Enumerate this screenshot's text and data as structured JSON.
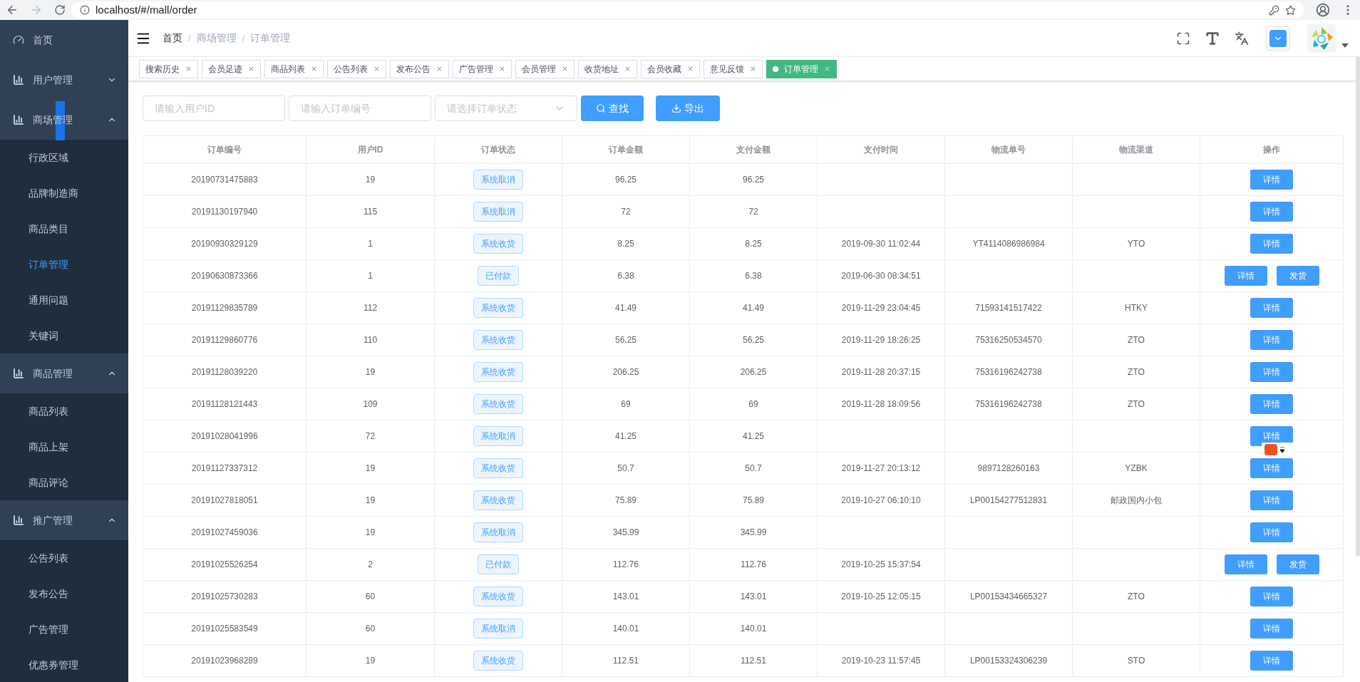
{
  "browser": {
    "url": "localhost/#/mall/order"
  },
  "sidebar": {
    "items": [
      {
        "label": "首页",
        "kind": "link",
        "selected": false
      },
      {
        "label": "用户管理",
        "kind": "group",
        "expanded": false
      },
      {
        "label": "商场管理",
        "kind": "group",
        "expanded": true,
        "children": [
          {
            "label": "行政区域",
            "selected": false
          },
          {
            "label": "品牌制造商",
            "selected": false
          },
          {
            "label": "商品类目",
            "selected": false
          },
          {
            "label": "订单管理",
            "selected": true
          },
          {
            "label": "通用问题",
            "selected": false
          },
          {
            "label": "关键词",
            "selected": false
          }
        ]
      },
      {
        "label": "商品管理",
        "kind": "group",
        "expanded": true,
        "children": [
          {
            "label": "商品列表",
            "selected": false
          },
          {
            "label": "商品上架",
            "selected": false
          },
          {
            "label": "商品评论",
            "selected": false
          }
        ]
      },
      {
        "label": "推广管理",
        "kind": "group",
        "expanded": true,
        "children": [
          {
            "label": "公告列表",
            "selected": false
          },
          {
            "label": "发布公告",
            "selected": false
          },
          {
            "label": "广告管理",
            "selected": false
          },
          {
            "label": "优惠券管理",
            "selected": false
          }
        ]
      }
    ]
  },
  "breadcrumb": {
    "separator": "/",
    "items": [
      "首页",
      "商场管理",
      "订单管理"
    ]
  },
  "tags": [
    {
      "label": "搜索历史",
      "selected": false
    },
    {
      "label": "会员足迹",
      "selected": false
    },
    {
      "label": "商品列表",
      "selected": false
    },
    {
      "label": "公告列表",
      "selected": false
    },
    {
      "label": "发布公告",
      "selected": false
    },
    {
      "label": "广告管理",
      "selected": false
    },
    {
      "label": "会员管理",
      "selected": false
    },
    {
      "label": "收货地址",
      "selected": false
    },
    {
      "label": "会员收藏",
      "selected": false
    },
    {
      "label": "意见反馈",
      "selected": false
    },
    {
      "label": "订单管理",
      "selected": true
    }
  ],
  "filters": {
    "user_id": {
      "placeholder": "请输入用户ID"
    },
    "order_no": {
      "placeholder": "请输入订单编号"
    },
    "status": {
      "placeholder": "请选择订单状态"
    },
    "search_button": "查找",
    "export_button": "导出"
  },
  "table": {
    "columns": [
      "订单编号",
      "用户ID",
      "订单状态",
      "订单金额",
      "支付金额",
      "支付时间",
      "物流单号",
      "物流渠道",
      "操作"
    ],
    "rows": [
      {
        "cells": [
          "20190731475883",
          "19",
          "系统取消",
          "96.25",
          "96.25",
          "",
          "",
          ""
        ],
        "actions": [
          "详情"
        ]
      },
      {
        "cells": [
          "20191130197940",
          "115",
          "系统取消",
          "72",
          "72",
          "",
          "",
          ""
        ],
        "actions": [
          "详情"
        ]
      },
      {
        "cells": [
          "20190930329129",
          "1",
          "系统收货",
          "8.25",
          "8.25",
          "2019-09-30 11:02:44",
          "YT4114086986984",
          "YTO"
        ],
        "actions": [
          "详情"
        ]
      },
      {
        "cells": [
          "20190630873366",
          "1",
          "已付款",
          "6.38",
          "6.38",
          "2019-06-30 08:34:51",
          "",
          ""
        ],
        "actions": [
          "详情",
          "发货"
        ]
      },
      {
        "cells": [
          "20191129835789",
          "112",
          "系统收货",
          "41.49",
          "41.49",
          "2019-11-29 23:04:45",
          "71593141517422",
          "HTKY"
        ],
        "actions": [
          "详情"
        ]
      },
      {
        "cells": [
          "20191129860776",
          "110",
          "系统收货",
          "56.25",
          "56.25",
          "2019-11-29 18:26:25",
          "75316250534570",
          "ZTO"
        ],
        "actions": [
          "详情"
        ]
      },
      {
        "cells": [
          "20191128039220",
          "19",
          "系统收货",
          "206.25",
          "206.25",
          "2019-11-28 20:37:15",
          "75316196242738",
          "ZTO"
        ],
        "actions": [
          "详情"
        ]
      },
      {
        "cells": [
          "20191128121443",
          "109",
          "系统收货",
          "69",
          "69",
          "2019-11-28 18:09:56",
          "75316196242738",
          "ZTO"
        ],
        "actions": [
          "详情"
        ]
      },
      {
        "cells": [
          "20191028041996",
          "72",
          "系统取消",
          "41.25",
          "41.25",
          "",
          "",
          ""
        ],
        "actions": [
          "详情"
        ]
      },
      {
        "cells": [
          "20191127337312",
          "19",
          "系统收货",
          "50.7",
          "50.7",
          "2019-11-27 20:13:12",
          "9897128260163",
          "YZBK"
        ],
        "actions": [
          "详情"
        ]
      },
      {
        "cells": [
          "20191027818051",
          "19",
          "系统收货",
          "75.89",
          "75.89",
          "2019-10-27 06:10:10",
          "LP00154277512831",
          "邮政国内小包"
        ],
        "actions": [
          "详情"
        ]
      },
      {
        "cells": [
          "20191027459036",
          "19",
          "系统取消",
          "345.99",
          "345.99",
          "",
          "",
          ""
        ],
        "actions": [
          "详情"
        ]
      },
      {
        "cells": [
          "20191025526254",
          "2",
          "已付款",
          "112.76",
          "112.76",
          "2019-10-25 15:37:54",
          "",
          ""
        ],
        "actions": [
          "详情",
          "发货"
        ]
      },
      {
        "cells": [
          "20191025730283",
          "60",
          "系统收货",
          "143.01",
          "143.01",
          "2019-10-25 12:05:15",
          "LP00153434665327",
          "ZTO"
        ],
        "actions": [
          "详情"
        ]
      },
      {
        "cells": [
          "20191025583549",
          "60",
          "系统取消",
          "140.01",
          "140.01",
          "",
          "",
          ""
        ],
        "actions": [
          "详情"
        ]
      },
      {
        "cells": [
          "20191023968289",
          "19",
          "系统收货",
          "112.51",
          "112.51",
          "2019-10-23 11:57:45",
          "LP00153324306239",
          "STO"
        ],
        "actions": [
          "详情"
        ]
      }
    ]
  }
}
